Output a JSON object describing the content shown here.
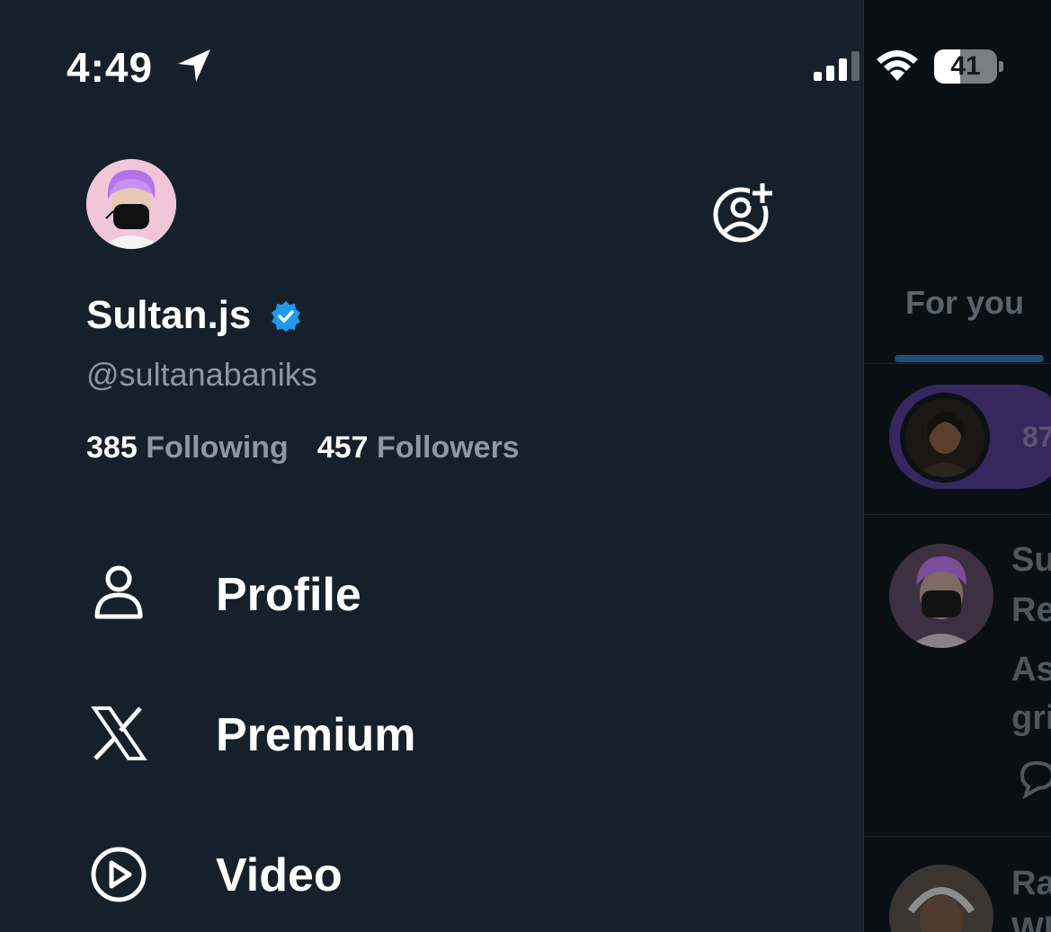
{
  "status_bar": {
    "time": "4:49",
    "battery_percent": "41",
    "battery_level": 0.41
  },
  "drawer": {
    "display_name": "Sultan.js",
    "handle": "@sultanabaniks",
    "following_count": "385",
    "following_label": "Following",
    "followers_count": "457",
    "followers_label": "Followers",
    "menu": [
      {
        "label": "Profile",
        "icon": "person-icon"
      },
      {
        "label": "Premium",
        "icon": "x-logo-icon"
      },
      {
        "label": "Video",
        "icon": "play-circle-icon"
      }
    ]
  },
  "timeline": {
    "tab_label": "For you",
    "spaces_count_partial": "87",
    "post1_name_partial": "Su",
    "post1_sub_partial": "Re",
    "post1_text_line1": "As",
    "post1_text_line2": "gri",
    "post2_name_partial": "Ra",
    "post2_sub_partial": "Wl"
  },
  "colors": {
    "background": "#15202b",
    "secondary_text": "#8b98a5",
    "verified": "#1d9bf0"
  }
}
